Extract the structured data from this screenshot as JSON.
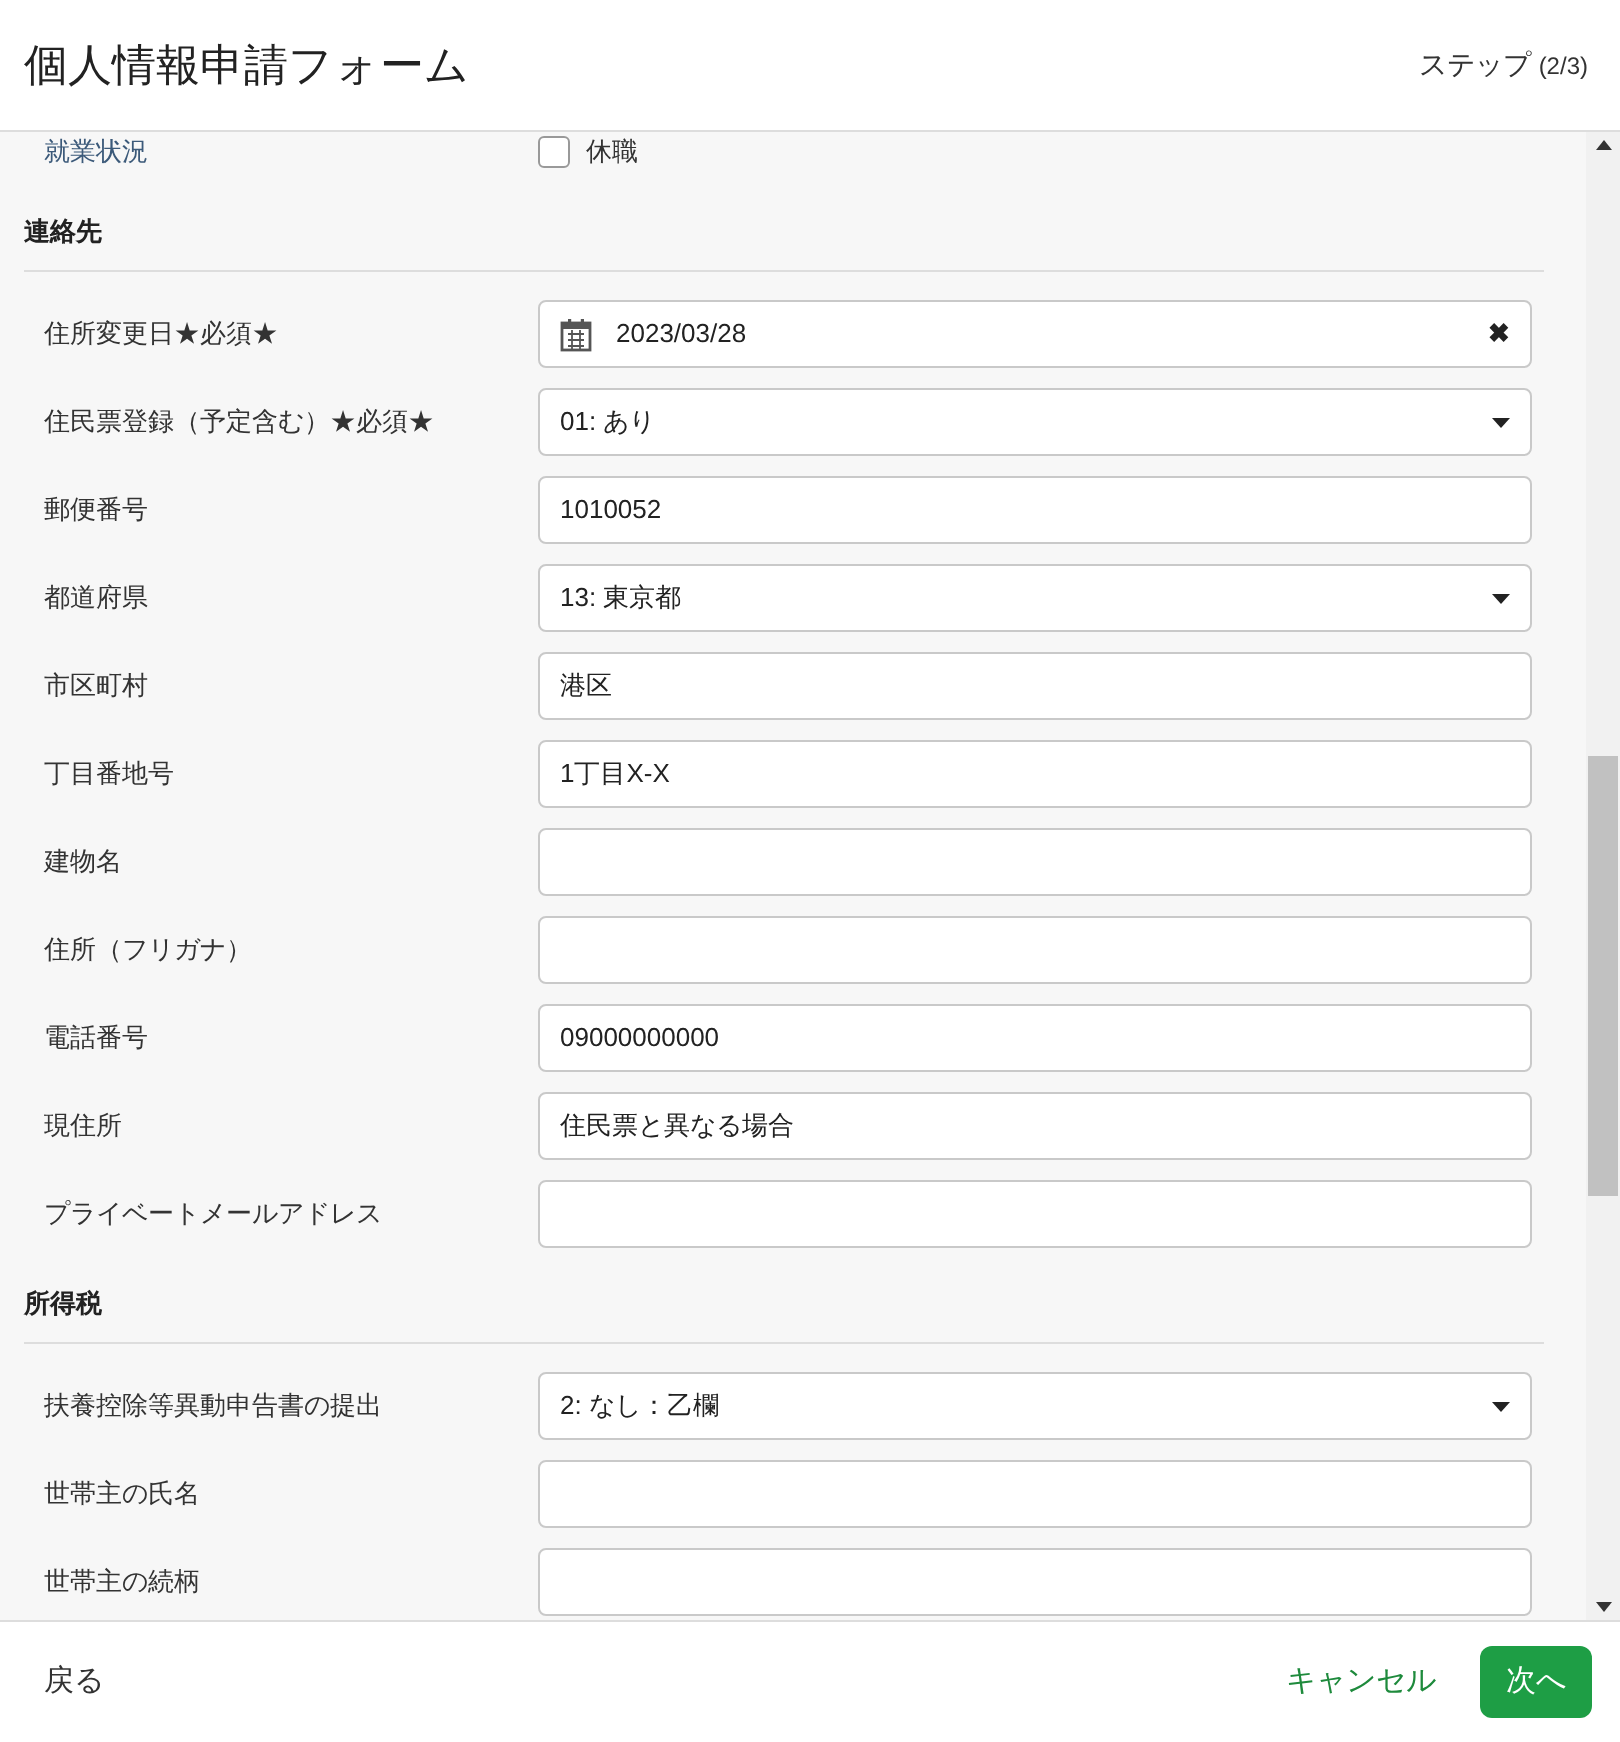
{
  "header": {
    "title": "個人情報申請フォーム",
    "step": "ステップ",
    "step_count": "(2/3)"
  },
  "partial_row": {
    "label": "就業状況",
    "checkbox_label": "休職",
    "checked": false
  },
  "sections": [
    {
      "title": "連絡先",
      "fields": [
        {
          "label": "住所変更日★必須★",
          "kind": "date",
          "value": "2023/03/28",
          "clear": "✖"
        },
        {
          "label": "住民票登録（予定含む）★必須★",
          "kind": "select",
          "value": "01: あり"
        },
        {
          "label": "郵便番号",
          "kind": "text",
          "value": "1010052"
        },
        {
          "label": "都道府県",
          "kind": "select",
          "value": "13: 東京都"
        },
        {
          "label": "市区町村",
          "kind": "text",
          "value": "港区"
        },
        {
          "label": "丁目番地号",
          "kind": "text",
          "value": "1丁目X-X"
        },
        {
          "label": "建物名",
          "kind": "text"
        },
        {
          "label": "住所（フリガナ）",
          "kind": "text"
        },
        {
          "label": "電話番号",
          "kind": "text",
          "value": "09000000000"
        },
        {
          "label": "現住所",
          "kind": "text",
          "value": "住民票と異なる場合"
        },
        {
          "label": "プライベートメールアドレス",
          "kind": "text"
        }
      ]
    },
    {
      "title": "所得税",
      "fields": [
        {
          "label": "扶養控除等異動申告書の提出",
          "kind": "select",
          "value": "2: なし：乙欄"
        },
        {
          "label": "世帯主の氏名",
          "kind": "text"
        },
        {
          "label": "世帯主の続柄",
          "kind": "text"
        }
      ]
    }
  ],
  "footer": {
    "back": "戻る",
    "cancel": "キャンセル",
    "next": "次へ"
  }
}
